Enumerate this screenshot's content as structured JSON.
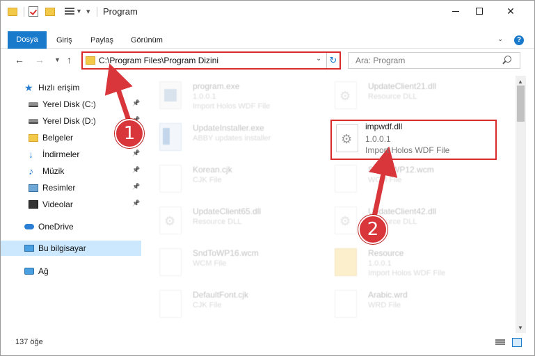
{
  "window": {
    "title": "Program",
    "controls": {
      "minimize": "minimize",
      "maximize": "maximize",
      "close": "✕"
    }
  },
  "ribbon": {
    "tabs": [
      "Dosya",
      "Giriş",
      "Paylaş",
      "Görünüm"
    ],
    "help": "?"
  },
  "nav": {
    "back": "←",
    "forward": "→",
    "up": "↑",
    "address": "C:\\Program Files\\Program Dizini",
    "search_placeholder": "Ara: Program",
    "refresh": "↻"
  },
  "sidebar": {
    "items": [
      {
        "label": "Hızlı erişim",
        "icon": "star-icon",
        "pinned": false
      },
      {
        "label": "Yerel Disk (C:)",
        "icon": "drive-icon",
        "pinned": true
      },
      {
        "label": "Yerel Disk (D:)",
        "icon": "drive-icon",
        "pinned": true
      },
      {
        "label": "Belgeler",
        "icon": "documents-folder-icon",
        "pinned": true
      },
      {
        "label": "İndirmeler",
        "icon": "download-icon",
        "pinned": true
      },
      {
        "label": "Müzik",
        "icon": "music-icon",
        "pinned": true
      },
      {
        "label": "Resimler",
        "icon": "pictures-icon",
        "pinned": true
      },
      {
        "label": "Videolar",
        "icon": "video-icon",
        "pinned": true
      },
      {
        "label": "OneDrive",
        "icon": "cloud-icon",
        "pinned": false
      },
      {
        "label": "Bu bilgisayar",
        "icon": "computer-icon",
        "pinned": false,
        "selected": true
      },
      {
        "label": "Ağ",
        "icon": "network-icon",
        "pinned": false
      }
    ]
  },
  "files": [
    {
      "name": "program.exe",
      "line2": "1.0.0.1",
      "line3": "Import Holos WDF File",
      "type": "exe",
      "highlighted": false
    },
    {
      "name": "UpdateClient21.dll",
      "line2": "Resource DLL",
      "line3": "",
      "type": "dll",
      "highlighted": false
    },
    {
      "name": "UpdateInstaller.exe",
      "line2": "ABBY updates installer",
      "line3": "",
      "type": "installer",
      "highlighted": false
    },
    {
      "name": "impwdf.dll",
      "line2": "1.0.0.1",
      "line3": "Import Holos WDF File",
      "type": "dll",
      "highlighted": true
    },
    {
      "name": "Korean.cjk",
      "line2": "CJK File",
      "line3": "",
      "type": "blank",
      "highlighted": false
    },
    {
      "name": "SndToWP12.wcm",
      "line2": "WCM File",
      "line3": "",
      "type": "blank",
      "highlighted": false
    },
    {
      "name": "UpdateClient65.dll",
      "line2": "Resource DLL",
      "line3": "",
      "type": "dll",
      "highlighted": false
    },
    {
      "name": "UpdateClient42.dll",
      "line2": "Resource DLL",
      "line3": "",
      "type": "dll",
      "highlighted": false
    },
    {
      "name": "SndToWP16.wcm",
      "line2": "WCM File",
      "line3": "",
      "type": "blank",
      "highlighted": false
    },
    {
      "name": "Resource",
      "line2": "1.0.0.1",
      "line3": "Import Holos WDF File",
      "type": "folder",
      "highlighted": false
    },
    {
      "name": "DefaultFont.cjk",
      "line2": "CJK File",
      "line3": "",
      "type": "blank",
      "highlighted": false
    },
    {
      "name": "Arabic.wrd",
      "line2": "WRD File",
      "line3": "",
      "type": "blank",
      "highlighted": false
    }
  ],
  "status": {
    "item_count": "137 öğe"
  },
  "annotations": {
    "step1": "1",
    "step2": "2",
    "accent": "#d8363a"
  }
}
